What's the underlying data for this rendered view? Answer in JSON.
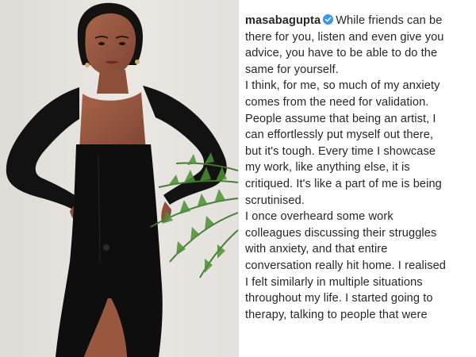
{
  "post": {
    "username": "masabagupta",
    "verified_icon": "verified-badge-icon",
    "badge_color": "#3897f0",
    "caption_lines": [
      "While friends can be",
      "there for you, listen and even give you",
      "advice, you have to be able to do the",
      "same for yourself.",
      "I think, for me, so much of my anxiety",
      "comes from the need for validation.",
      "People assume that being an artist, I",
      "can effortlessly put myself out there,",
      "but it's tough. Every time I showcase",
      "my work, like anything else, it is",
      "critiqued. It's like a part of me is being",
      "scrutinised.",
      "I once overheard some work",
      "colleagues discussing their struggles",
      "with anxiety, and that entire",
      "conversation really hit home. I realised",
      "I felt similarly in multiple situations",
      "throughout my life. I started going to",
      "therapy, talking to people that were"
    ]
  },
  "photo": {
    "description_icon": "portrait-photo"
  }
}
